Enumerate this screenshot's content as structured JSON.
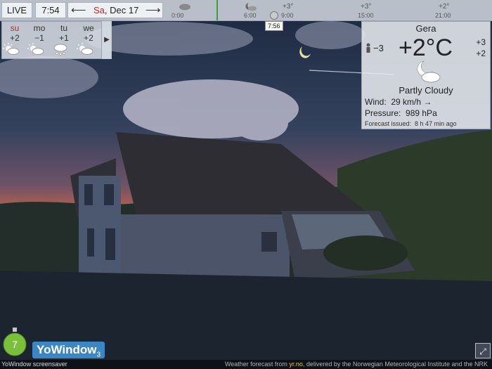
{
  "topbar": {
    "live_label": "LIVE",
    "clock": "7:54",
    "prev_arrow": "⟵",
    "next_arrow": "⟶",
    "date_day": "Sa",
    "date_rest": ", Dec 17",
    "timeline": {
      "ticks": [
        "0:00",
        "6:00",
        "9:00",
        "15:00",
        "21:00"
      ],
      "temps": [
        "+3°",
        "+3°",
        "+2°"
      ],
      "tooltip_time": "7:56"
    }
  },
  "days": [
    {
      "name": "su",
      "temp": "+2",
      "icon": "partly-cloudy-sun-icon"
    },
    {
      "name": "mo",
      "temp": "−1",
      "icon": "partly-cloudy-sun-icon"
    },
    {
      "name": "tu",
      "temp": "+1",
      "icon": "snow-cloud-icon"
    },
    {
      "name": "we",
      "temp": "+2",
      "icon": "partly-cloudy-sun-icon"
    }
  ],
  "days_next": "▶",
  "current": {
    "city": "Gera",
    "temp": "+2°C",
    "feels_like": "−3",
    "hi": "+3",
    "lo": "+2",
    "condition": "Partly Cloudy",
    "wind_label": "Wind:",
    "wind_value": "29 km/h",
    "wind_dir": "→",
    "pressure_label": "Pressure:",
    "pressure_value": "989 hPa",
    "issued_label": "Forecast issued:",
    "issued_value": "8 h 47 min ago"
  },
  "bottom": {
    "logo_text": "YoWindow",
    "logo_version": "3",
    "screensaver_label": "YoWindow screensaver",
    "credit_prefix": "Weather forecast from ",
    "credit_link": "yr.no",
    "credit_suffix": ", delivered by the Norwegian Meteorological Institute and the NRK",
    "fullscreen_icon": "⤢"
  },
  "colors": {
    "sky_top": "#1f2c44",
    "sky_horizon": "#c8604c",
    "accent_green": "#3e9c3e",
    "sunday_red": "#c0282c"
  }
}
